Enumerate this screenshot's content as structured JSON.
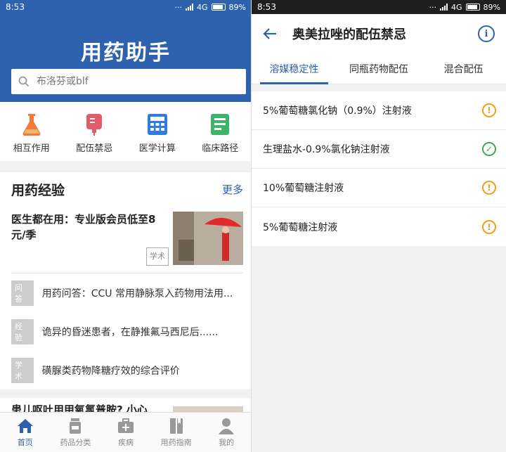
{
  "left": {
    "status": {
      "time": "8:53",
      "network": "4G",
      "battery": "89%",
      "battery_level": 0.89
    },
    "header": {
      "title": "用药助手"
    },
    "search": {
      "placeholder": "布洛芬或blf"
    },
    "quick_links": [
      {
        "label": "相互作用",
        "icon": "flask-icon",
        "color": "#f07a3a"
      },
      {
        "label": "配伍禁忌",
        "icon": "iv-bag-icon",
        "color": "#e35b6a"
      },
      {
        "label": "医学计算",
        "icon": "calculator-icon",
        "color": "#2f7be0"
      },
      {
        "label": "临床路径",
        "icon": "clipboard-icon",
        "color": "#3fb36b"
      }
    ],
    "experience": {
      "title": "用药经验",
      "more": "更多",
      "feature": {
        "title": "医生都在用：专业版会员低至8元/季",
        "tag": "学术"
      },
      "items": [
        {
          "tag": "问答",
          "text": "用药问答：CCU 常用静脉泵入药物用法用..."
        },
        {
          "tag": "经验",
          "text": "诡异的昏迷患者，在静推氟马西尼后......"
        },
        {
          "tag": "学术",
          "text": "磺脲类药物降糖疗效的综合评价"
        }
      ]
    },
    "second": {
      "title": "患儿呕吐用甲氧氯普胺? 小心"
    },
    "bottom_nav": [
      {
        "label": "首页",
        "icon": "home-icon",
        "active": true
      },
      {
        "label": "药品分类",
        "icon": "pill-bottle-icon",
        "active": false
      },
      {
        "label": "疾病",
        "icon": "medical-kit-icon",
        "active": false
      },
      {
        "label": "用药指南",
        "icon": "book-icon",
        "active": false
      },
      {
        "label": "我的",
        "icon": "person-icon",
        "active": false
      }
    ]
  },
  "right": {
    "status": {
      "time": "8:53",
      "network": "4G",
      "battery": "89%",
      "battery_level": 0.89
    },
    "toolbar": {
      "title": "奥美拉唑的配伍禁忌",
      "info_glyph": "i"
    },
    "tabs": [
      {
        "label": "溶媒稳定性",
        "active": true
      },
      {
        "label": "同瓶药物配伍",
        "active": false
      },
      {
        "label": "混合配伍",
        "active": false
      }
    ],
    "drugs": [
      {
        "name": "5%葡萄糖氯化钠（0.9%）注射液",
        "status": "warning",
        "glyph": "!"
      },
      {
        "name": "生理盐水-0.9%氯化钠注射液",
        "status": "ok",
        "glyph": "✓"
      },
      {
        "name": "10%葡萄糖注射液",
        "status": "warning",
        "glyph": "!"
      },
      {
        "name": "5%葡萄糖注射液",
        "status": "warning",
        "glyph": "!"
      }
    ]
  }
}
